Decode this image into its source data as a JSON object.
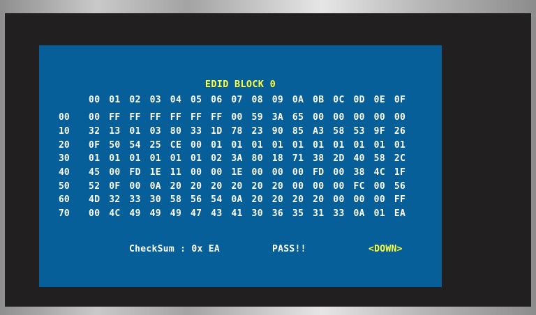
{
  "title": "EDID BLOCK 0",
  "column_headers": [
    "00",
    "01",
    "02",
    "03",
    "04",
    "05",
    "06",
    "07",
    "08",
    "09",
    "0A",
    "0B",
    "0C",
    "0D",
    "0E",
    "0F"
  ],
  "rows": [
    {
      "label": "00",
      "bytes": [
        "00",
        "FF",
        "FF",
        "FF",
        "FF",
        "FF",
        "FF",
        "00",
        "59",
        "3A",
        "65",
        "00",
        "00",
        "00",
        "00",
        "00"
      ]
    },
    {
      "label": "10",
      "bytes": [
        "32",
        "13",
        "01",
        "03",
        "80",
        "33",
        "1D",
        "78",
        "23",
        "90",
        "85",
        "A3",
        "58",
        "53",
        "9F",
        "26"
      ]
    },
    {
      "label": "20",
      "bytes": [
        "0F",
        "50",
        "54",
        "25",
        "CE",
        "00",
        "01",
        "01",
        "01",
        "01",
        "01",
        "01",
        "01",
        "01",
        "01",
        "01"
      ]
    },
    {
      "label": "30",
      "bytes": [
        "01",
        "01",
        "01",
        "01",
        "01",
        "01",
        "02",
        "3A",
        "80",
        "18",
        "71",
        "38",
        "2D",
        "40",
        "58",
        "2C"
      ]
    },
    {
      "label": "40",
      "bytes": [
        "45",
        "00",
        "FD",
        "1E",
        "11",
        "00",
        "00",
        "1E",
        "00",
        "00",
        "00",
        "FD",
        "00",
        "38",
        "4C",
        "1F"
      ]
    },
    {
      "label": "50",
      "bytes": [
        "52",
        "0F",
        "00",
        "0A",
        "20",
        "20",
        "20",
        "20",
        "20",
        "20",
        "00",
        "00",
        "00",
        "FC",
        "00",
        "56"
      ]
    },
    {
      "label": "60",
      "bytes": [
        "4D",
        "32",
        "33",
        "30",
        "58",
        "56",
        "54",
        "0A",
        "20",
        "20",
        "20",
        "20",
        "00",
        "00",
        "00",
        "FF"
      ]
    },
    {
      "label": "70",
      "bytes": [
        "00",
        "4C",
        "49",
        "49",
        "49",
        "47",
        "43",
        "41",
        "30",
        "36",
        "35",
        "31",
        "33",
        "0A",
        "01",
        "EA"
      ]
    }
  ],
  "footer": {
    "checksum": "CheckSum : 0x EA",
    "status": "PASS!!",
    "nav": "<DOWN>"
  },
  "colors": {
    "panel_bg": "#075f99",
    "screen_bg": "#221f20",
    "text": "#ffffff",
    "highlight": "#ffff3c"
  }
}
